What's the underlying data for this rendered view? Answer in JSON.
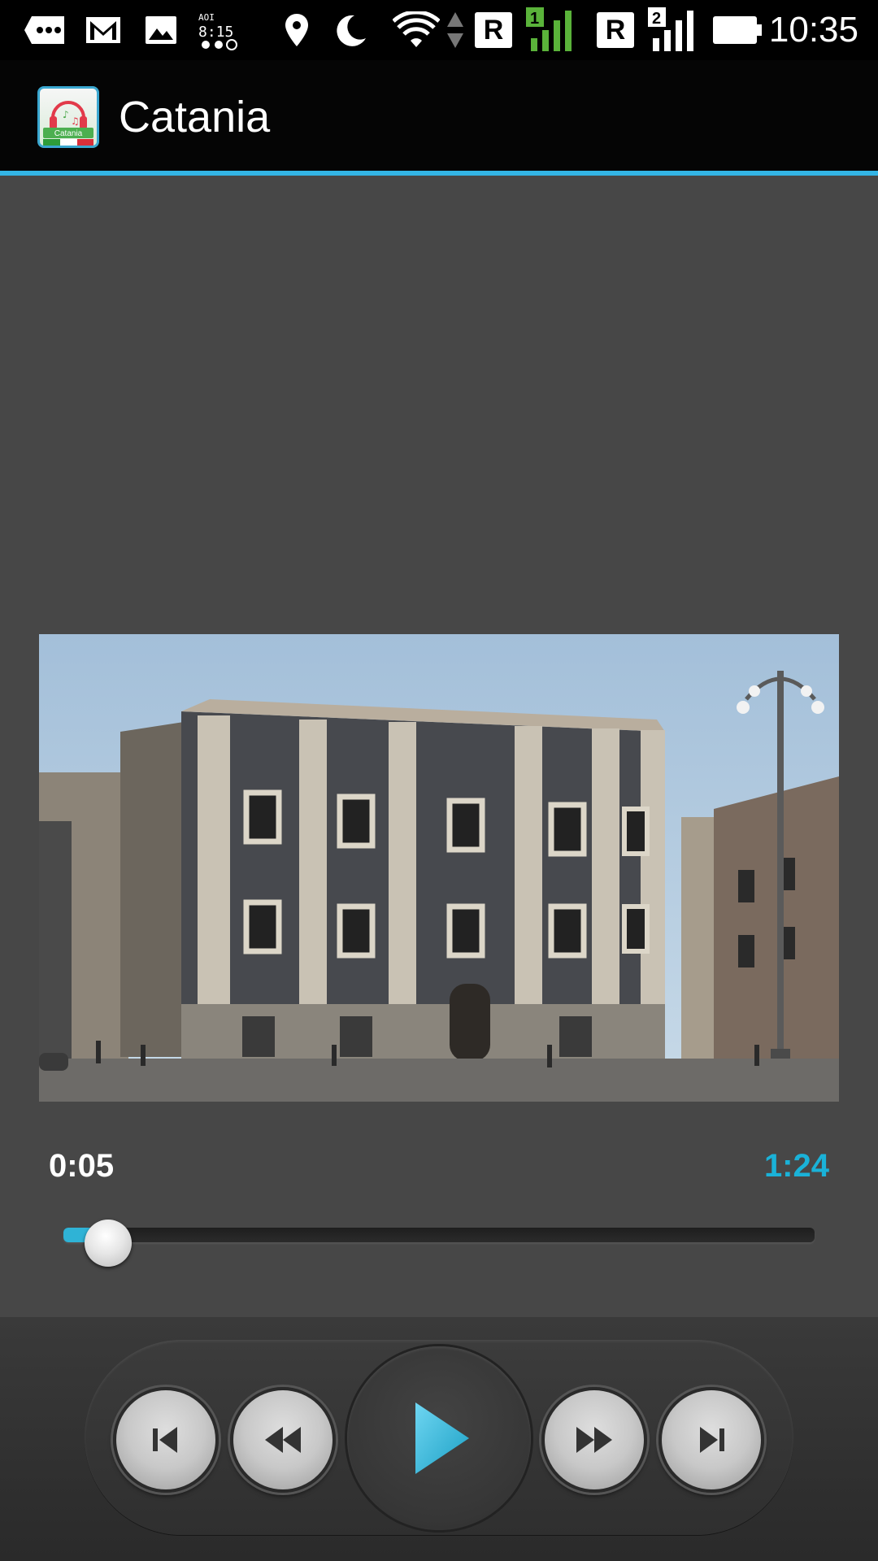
{
  "status_bar": {
    "time": "10:35",
    "icons": [
      "more-notifications-icon",
      "gmail-icon",
      "image-icon",
      "clock-widget-icon",
      "location-icon",
      "do-not-disturb-moon-icon",
      "wifi-icon",
      "data-arrows-icon",
      "roaming-r-icon",
      "signal-sim1-icon",
      "roaming-r-icon",
      "signal-sim2-icon",
      "battery-icon"
    ],
    "sim1_label": "1",
    "sim2_label": "2",
    "roaming_label": "R"
  },
  "app_bar": {
    "title": "Catania",
    "icon_label": "Catania",
    "accent_color": "#33b5e5"
  },
  "player": {
    "current_time": "0:05",
    "total_time": "1:24",
    "progress_fraction": 0.06,
    "accent_color": "#1ab2d8"
  },
  "controls": [
    "skip-previous-icon",
    "rewind-icon",
    "play-icon",
    "fast-forward-icon",
    "skip-next-icon"
  ]
}
